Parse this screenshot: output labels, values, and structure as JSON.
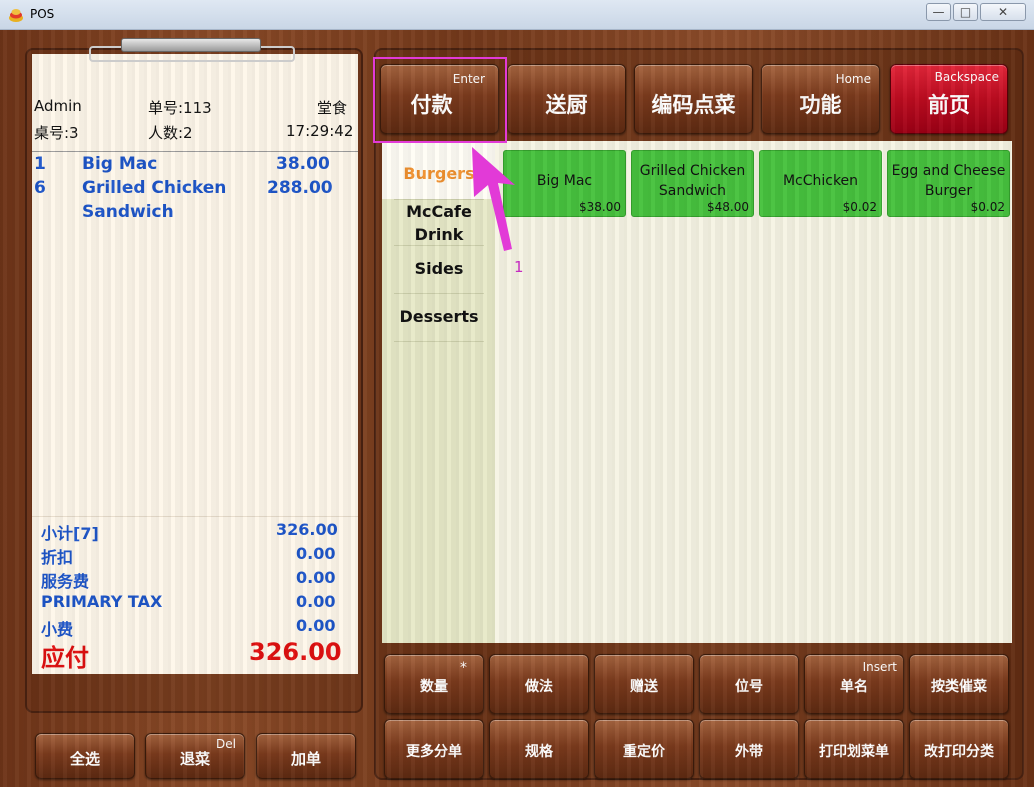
{
  "window": {
    "title": "POS",
    "min": "—",
    "max": "□",
    "close": "✕"
  },
  "receipt": {
    "user": "Admin",
    "order_no": "单号:113",
    "dine_type": "堂食",
    "table_no": "桌号:3",
    "guests": "人数:2",
    "time": "17:29:42",
    "items": [
      {
        "qty": "1",
        "name": "Big Mac",
        "name2": "",
        "price": "38.00"
      },
      {
        "qty": "6",
        "name": "Grilled Chicken",
        "name2": "Sandwich",
        "price": "288.00"
      }
    ],
    "totals": [
      {
        "label": "小计[7]",
        "value": "326.00"
      },
      {
        "label": "折扣",
        "value": "0.00"
      },
      {
        "label": "服务费",
        "value": "0.00"
      },
      {
        "label": "PRIMARY TAX",
        "value": "0.00"
      },
      {
        "label": "小费",
        "value": "0.00"
      }
    ],
    "grand_label": "应付",
    "grand_value": "326.00"
  },
  "left_buttons": [
    {
      "label": "全选",
      "hint": ""
    },
    {
      "label": "退菜",
      "hint": "Del"
    },
    {
      "label": "加单",
      "hint": ""
    }
  ],
  "top_buttons": [
    {
      "label": "付款",
      "hint": "Enter"
    },
    {
      "label": "送厨",
      "hint": ""
    },
    {
      "label": "编码点菜",
      "hint": ""
    },
    {
      "label": "功能",
      "hint": "Home"
    },
    {
      "label": "前页",
      "hint": "Backspace"
    }
  ],
  "categories": [
    "Burgers",
    "McCafe Drink",
    "Sides",
    "Desserts"
  ],
  "active_category": "Burgers",
  "products": [
    {
      "name": "Big Mac",
      "price": "$38.00"
    },
    {
      "name": "Grilled Chicken Sandwich",
      "price": "$48.00"
    },
    {
      "name": "McChicken",
      "price": "$0.02"
    },
    {
      "name": "Egg and Cheese Burger",
      "price": "$0.02"
    }
  ],
  "function_buttons_row1": [
    {
      "label": "数量",
      "hint": "*"
    },
    {
      "label": "做法",
      "hint": ""
    },
    {
      "label": "赠送",
      "hint": ""
    },
    {
      "label": "位号",
      "hint": ""
    },
    {
      "label": "单名",
      "hint": "Insert"
    },
    {
      "label": "按类催菜",
      "hint": ""
    }
  ],
  "function_buttons_row2": [
    {
      "label": "更多分单",
      "hint": ""
    },
    {
      "label": "规格",
      "hint": ""
    },
    {
      "label": "重定价",
      "hint": ""
    },
    {
      "label": "外带",
      "hint": ""
    },
    {
      "label": "打印划菜单",
      "hint": ""
    },
    {
      "label": "改打印分类",
      "hint": ""
    }
  ],
  "annotation": {
    "label": "1",
    "color": "#e23ad7"
  },
  "colors": {
    "category_active": "#f0912f",
    "item_text": "#1d55c9",
    "grand_total": "#e01010",
    "product_tile": "#47c23e"
  }
}
